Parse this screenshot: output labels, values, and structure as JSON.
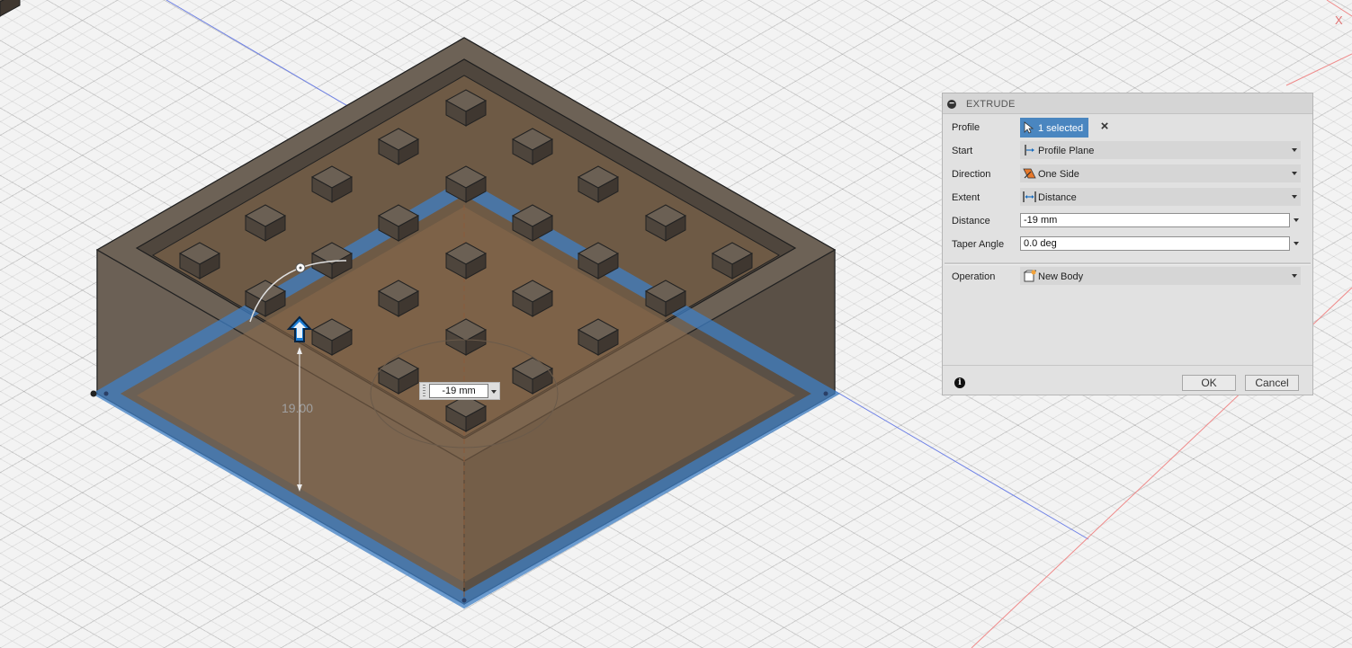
{
  "dialog": {
    "title": "EXTRUDE",
    "profile": {
      "label": "Profile",
      "value": "1 selected"
    },
    "start": {
      "label": "Start",
      "value": "Profile Plane",
      "icon": "profile-plane-icon"
    },
    "direction": {
      "label": "Direction",
      "value": "One Side",
      "icon": "one-side-icon"
    },
    "extent": {
      "label": "Extent",
      "value": "Distance",
      "icon": "distance-icon"
    },
    "distance": {
      "label": "Distance",
      "value": "-19 mm"
    },
    "taper": {
      "label": "Taper Angle",
      "value": "0.0 deg"
    },
    "operation": {
      "label": "Operation",
      "value": "New Body",
      "icon": "new-body-icon"
    },
    "ok_label": "OK",
    "cancel_label": "Cancel"
  },
  "canvas": {
    "distance_input_value": "-19 mm",
    "dimension_label": "19.00",
    "axis_label": "X",
    "colors": {
      "selection": "#3f7fc4",
      "body": "#5e5348",
      "sketch_profile": "#8a6a4a"
    }
  }
}
